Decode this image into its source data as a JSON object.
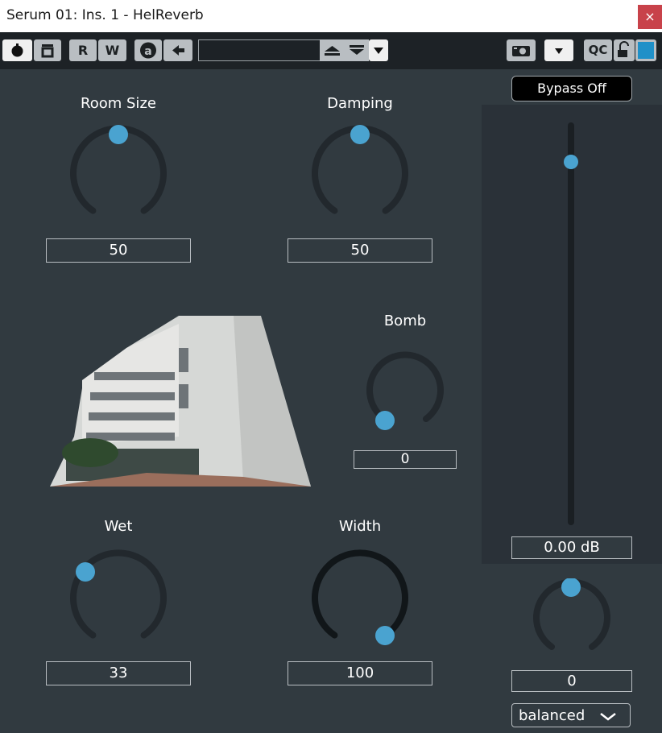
{
  "window": {
    "title": "Serum 01: Ins. 1 - HelReverb",
    "close_glyph": "×"
  },
  "toolbar": {
    "r_label": "R",
    "w_label": "W",
    "a_label": "a",
    "qc_label": "QC",
    "preset_name": ""
  },
  "knobs": {
    "room_size": {
      "label": "Room Size",
      "value": "50"
    },
    "damping": {
      "label": "Damping",
      "value": "50"
    },
    "bomb": {
      "label": "Bomb",
      "value": "0"
    },
    "wet": {
      "label": "Wet",
      "value": "33"
    },
    "width": {
      "label": "Width",
      "value": "100"
    },
    "pan": {
      "value": "0"
    }
  },
  "output": {
    "bypass_label": "Bypass Off",
    "gain_value": "0.00 dB",
    "mode": "balanced"
  },
  "colors": {
    "accent": "#4aa3d0",
    "panel": "#2a3138",
    "bg": "#313a40"
  }
}
